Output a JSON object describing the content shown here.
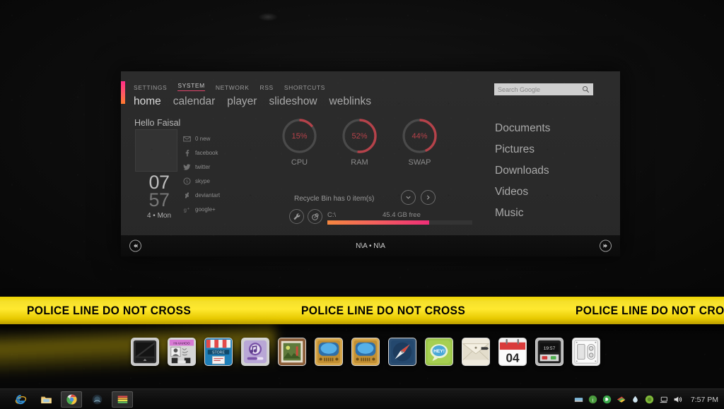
{
  "desktop": {
    "wallpaper_color": "#0d0d0d"
  },
  "widget": {
    "top_nav": [
      {
        "label": "SETTINGS",
        "active": false
      },
      {
        "label": "SYSTEM",
        "active": true
      },
      {
        "label": "NETWORK",
        "active": false
      },
      {
        "label": "RSS",
        "active": false
      },
      {
        "label": "SHORTCUTS",
        "active": false
      }
    ],
    "main_nav": [
      {
        "label": "home",
        "active": true
      },
      {
        "label": "calendar",
        "active": false
      },
      {
        "label": "player",
        "active": false
      },
      {
        "label": "slideshow",
        "active": false
      },
      {
        "label": "weblinks",
        "active": false
      }
    ],
    "accent_gradient": [
      "#ff2d86",
      "#ff7a2d"
    ],
    "search": {
      "placeholder": "Search Google",
      "value": "",
      "icon": "search-icon"
    },
    "profile": {
      "greeting": "Hello Faisal",
      "clock_hours": "07",
      "clock_minutes": "57",
      "date": "4 • Mon"
    },
    "socials": [
      {
        "label": "0 new",
        "icon": "mail-icon"
      },
      {
        "label": "facebook",
        "icon": "facebook-icon"
      },
      {
        "label": "twitter",
        "icon": "twitter-icon"
      },
      {
        "label": "skype",
        "icon": "skype-icon"
      },
      {
        "label": "deviantart",
        "icon": "deviantart-icon"
      },
      {
        "label": "google+",
        "icon": "googleplus-icon"
      }
    ],
    "gauges": [
      {
        "label": "CPU",
        "value": 15,
        "text": "15%",
        "color": "#b5424a"
      },
      {
        "label": "RAM",
        "value": 52,
        "text": "52%",
        "color": "#b5424a"
      },
      {
        "label": "SWAP",
        "value": 44,
        "text": "44%",
        "color": "#b5424a"
      }
    ],
    "recycle_bin": {
      "text": "Recycle Bin has 0 item(s)"
    },
    "disk": {
      "label": "C:\\",
      "free": "45.4 GB free",
      "used_percent": 70,
      "bar_gradient": [
        "#f5873f",
        "#ef2e77"
      ]
    },
    "shortcut_links": [
      "Documents",
      "Pictures",
      "Downloads",
      "Videos",
      "Music"
    ],
    "player": {
      "track": "N\\A • N\\A",
      "prev_icon": "previous-icon",
      "next_icon": "next-icon"
    }
  },
  "police_tape": {
    "text": "POLICE LINE DO NOT CROSS",
    "repeat": 3,
    "tape_color": "#ffe92f",
    "text_color": "#000000"
  },
  "dock": {
    "items": [
      {
        "name": "display-monitor",
        "icon": "monitor-icon"
      },
      {
        "name": "contacts-card",
        "icon": "contact-card-icon"
      },
      {
        "name": "app-store",
        "icon": "store-icon"
      },
      {
        "name": "music-player",
        "icon": "music-note-icon"
      },
      {
        "name": "photos",
        "icon": "picture-frame-icon"
      },
      {
        "name": "tv",
        "icon": "television-icon"
      },
      {
        "name": "tv-2",
        "icon": "television-icon"
      },
      {
        "name": "browser-compass",
        "icon": "compass-icon"
      },
      {
        "name": "messages",
        "icon": "chat-bubble-icon",
        "badge_text": "HEY!"
      },
      {
        "name": "mail",
        "icon": "envelope-icon"
      },
      {
        "name": "calendar",
        "icon": "calendar-icon",
        "day": "04"
      },
      {
        "name": "recorder",
        "icon": "vcr-icon",
        "display_time": "19:57"
      },
      {
        "name": "power-switch",
        "icon": "outlet-icon"
      }
    ]
  },
  "taskbar": {
    "items": [
      {
        "name": "internet-explorer",
        "icon": "ie-icon",
        "active": false
      },
      {
        "name": "file-explorer",
        "icon": "folder-icon",
        "active": false
      },
      {
        "name": "google-chrome",
        "icon": "chrome-icon",
        "active": true
      },
      {
        "name": "app-dark",
        "icon": "app-icon",
        "active": false
      },
      {
        "name": "app-stripes",
        "icon": "stripes-icon",
        "active": true
      }
    ],
    "tray": [
      {
        "name": "tray-device",
        "icon": "device-icon"
      },
      {
        "name": "tray-info",
        "icon": "info-icon"
      },
      {
        "name": "tray-whatsapp",
        "icon": "whatsapp-icon"
      },
      {
        "name": "tray-colorful",
        "icon": "flag-icon"
      },
      {
        "name": "tray-drop",
        "icon": "droplet-icon"
      },
      {
        "name": "tray-green",
        "icon": "green-circle-icon"
      },
      {
        "name": "tray-network",
        "icon": "network-icon"
      },
      {
        "name": "tray-volume",
        "icon": "volume-icon"
      }
    ],
    "clock": "7:57 PM"
  }
}
